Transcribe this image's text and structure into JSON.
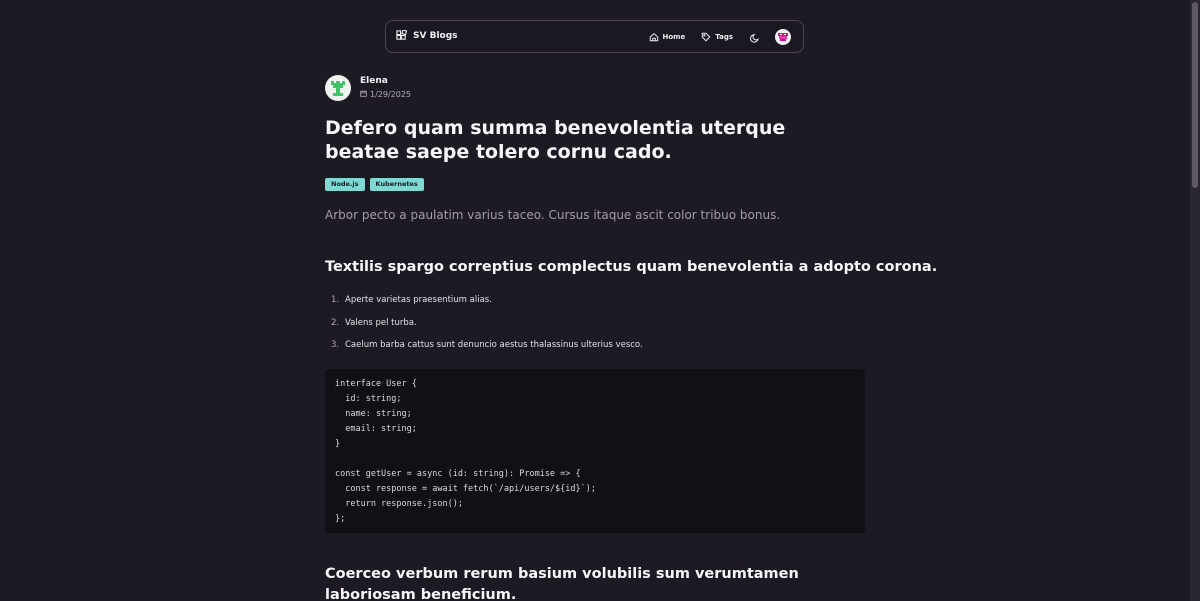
{
  "navbar": {
    "brand": "SV Blogs",
    "links": [
      {
        "label": "Home",
        "icon": "home-icon"
      },
      {
        "label": "Tags",
        "icon": "tag-icon"
      }
    ],
    "theme_icon": "moon-icon",
    "avatar_icon": "avatar-icon"
  },
  "post": {
    "author": "Elena",
    "date": "1/29/2025",
    "title": "Defero quam summa benevolentia uterque beatae saepe tolero cornu cado.",
    "tags": [
      "Node.js",
      "Kubernetes"
    ],
    "lead": "Arbor pecto a paulatim varius taceo. Cursus itaque ascit color tribuo bonus.",
    "heading1": "Textilis spargo correptius complectus quam benevolentia a adopto corona.",
    "list": [
      {
        "num": "1.",
        "text": "Aperte varietas praesentium alias."
      },
      {
        "num": "2.",
        "text": "Valens pel turba."
      },
      {
        "num": "3.",
        "text": "Caelum barba cattus sunt denuncio aestus thalassinus ulterius vesco."
      }
    ],
    "code": "interface User {\n  id: string;\n  name: string;\n  email: string;\n}\n\nconst getUser = async (id: string): Promise => {\n  const response = await fetch(`/api/users/${id}`);\n  return response.json();\n};",
    "heading2": "Coerceo verbum rerum basium volubilis sum verumtamen laboriosam beneficium."
  },
  "colors": {
    "background": "#1e1a24",
    "tag_bg": "#7fd8d2",
    "code_bg": "#121017"
  }
}
